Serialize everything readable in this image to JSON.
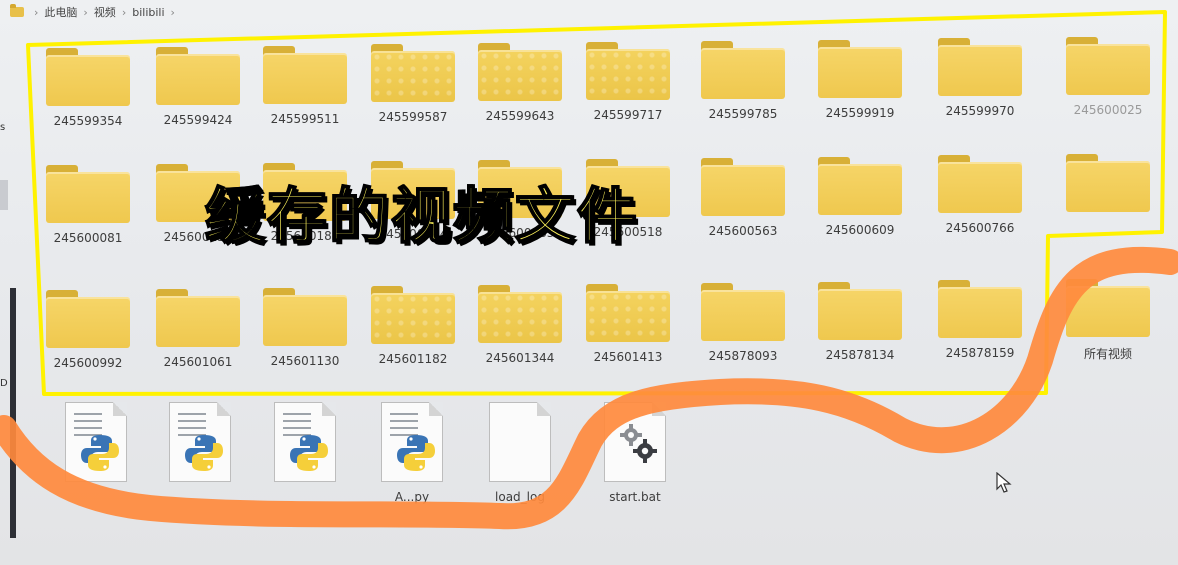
{
  "breadcrumb": {
    "items": [
      "此电脑",
      "视频",
      "bilibili"
    ]
  },
  "sidebar": {
    "fragments": [
      "s",
      "D"
    ]
  },
  "folders": [
    {
      "name": "245599354"
    },
    {
      "name": "245599424"
    },
    {
      "name": "245599511"
    },
    {
      "name": "245599587"
    },
    {
      "name": "245599643"
    },
    {
      "name": "245599717"
    },
    {
      "name": "245599785"
    },
    {
      "name": "245599919"
    },
    {
      "name": "245599970"
    },
    {
      "name": "245600025"
    },
    {
      "name": "245600081"
    },
    {
      "name": "245600138"
    },
    {
      "name": "245600188"
    },
    {
      "name": "245600324"
    },
    {
      "name": "245600463"
    },
    {
      "name": "245600518"
    },
    {
      "name": "245600563"
    },
    {
      "name": "245600609"
    },
    {
      "name": "245600766"
    },
    {
      "name": ""
    },
    {
      "name": "245600992"
    },
    {
      "name": "245601061"
    },
    {
      "name": "245601130"
    },
    {
      "name": "245601182"
    },
    {
      "name": "245601344"
    },
    {
      "name": "245601413"
    },
    {
      "name": "245878093"
    },
    {
      "name": "245878134"
    },
    {
      "name": "245878159"
    },
    {
      "name": "所有视频"
    }
  ],
  "files": [
    {
      "name": "",
      "icon": "python-file-icon"
    },
    {
      "name": "",
      "icon": "python-file-icon"
    },
    {
      "name": "",
      "icon": "python-file-icon"
    },
    {
      "name": "A...py",
      "icon": "python-file-icon"
    },
    {
      "name": "load_log",
      "icon": "text-file-icon"
    },
    {
      "name": "start.bat",
      "icon": "batch-file-icon"
    }
  ],
  "annotation": {
    "caption": "缓存的视频文件",
    "highlight_color": "#fff200",
    "scribble_color": "#ff8a3d"
  }
}
